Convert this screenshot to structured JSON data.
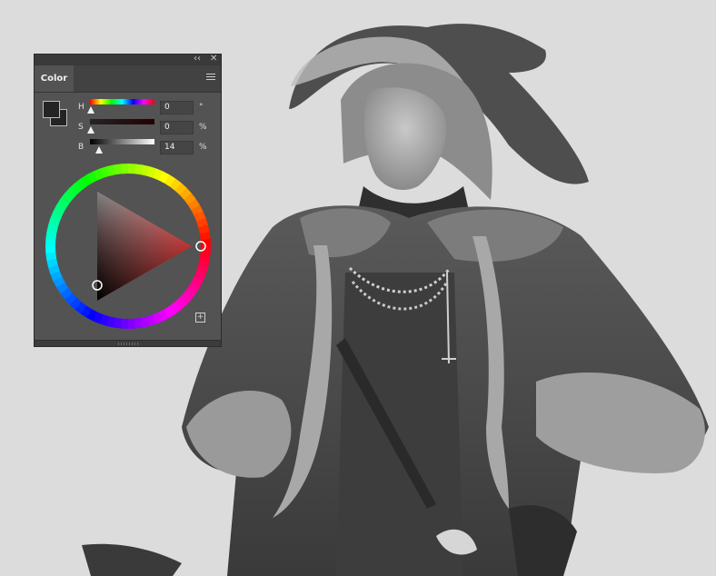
{
  "panel": {
    "tab_label": "Color",
    "collapse_icon": "double-chevron-left-icon",
    "close_icon": "close-icon",
    "menu_icon": "panel-menu-icon",
    "add_icon": "add-swatch-icon",
    "foreground_color": "#242424",
    "background_color": "#242424",
    "sliders": [
      {
        "label": "H",
        "value": "0",
        "unit": "°",
        "position": 0.0
      },
      {
        "label": "S",
        "value": "0",
        "unit": "%",
        "position": 0.0
      },
      {
        "label": "B",
        "value": "14",
        "unit": "%",
        "position": 0.14
      }
    ],
    "wheel_hue": 0
  }
}
